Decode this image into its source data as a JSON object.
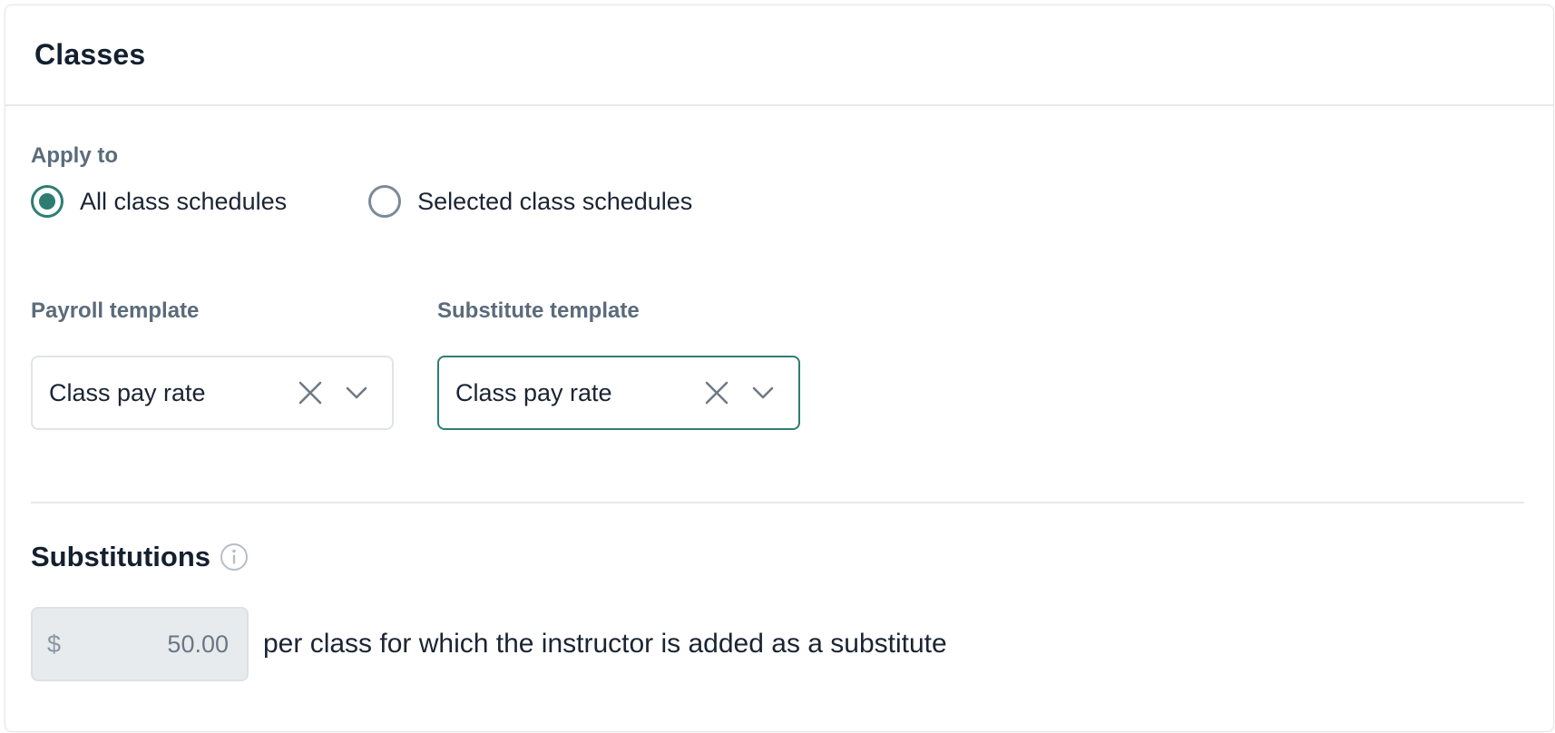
{
  "card": {
    "title": "Classes"
  },
  "apply_to": {
    "label": "Apply to",
    "options": [
      {
        "label": "All class schedules",
        "selected": true
      },
      {
        "label": "Selected class schedules",
        "selected": false
      }
    ]
  },
  "payroll_template": {
    "label": "Payroll template",
    "value": "Class pay rate"
  },
  "substitute_template": {
    "label": "Substitute template",
    "value": "Class pay rate"
  },
  "substitutions": {
    "title": "Substitutions",
    "currency_symbol": "$",
    "amount": "50.00",
    "suffix": "per class for which the instructor is added as a substitute"
  },
  "icons": {
    "clear": "close-icon",
    "dropdown": "chevron-down-icon",
    "info": "info-icon"
  },
  "colors": {
    "accent": "#2e7d72",
    "label": "#5b6b7b",
    "text": "#1a2433"
  }
}
